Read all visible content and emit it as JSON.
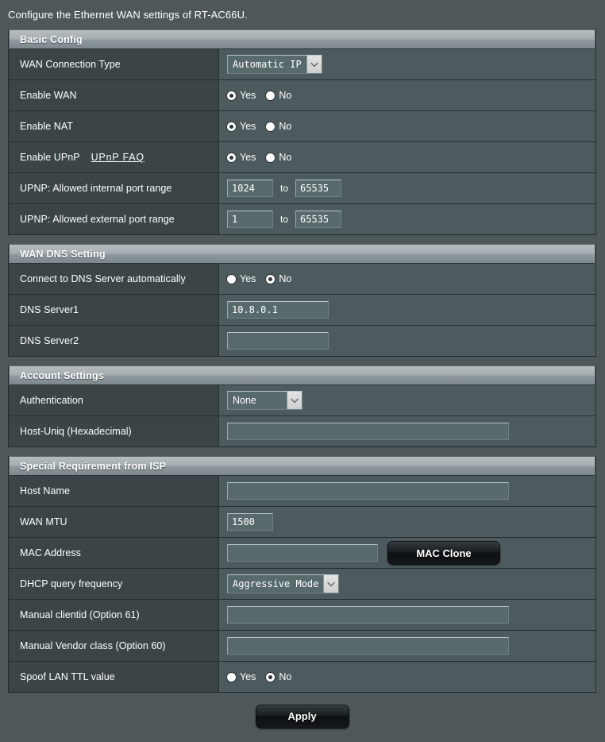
{
  "page": {
    "intro": "Configure the Ethernet WAN settings of RT-AC66U."
  },
  "sections": {
    "basic_config": {
      "title": "Basic Config",
      "rows": {
        "wan_connection_type": {
          "label": "WAN Connection Type",
          "value": "Automatic IP"
        },
        "enable_wan": {
          "label": "Enable WAN",
          "yes_label": "Yes",
          "no_label": "No",
          "selected": "Yes"
        },
        "enable_nat": {
          "label": "Enable NAT",
          "yes_label": "Yes",
          "no_label": "No",
          "selected": "Yes"
        },
        "enable_upnp": {
          "label": "Enable UPnP",
          "link_label": "UPnP  FAQ",
          "yes_label": "Yes",
          "no_label": "No",
          "selected": "Yes"
        },
        "upnp_internal_range": {
          "label": "UPNP: Allowed internal port range",
          "from": "1024",
          "separator": "to",
          "to": "65535"
        },
        "upnp_external_range": {
          "label": "UPNP: Allowed external port range",
          "from": "1",
          "separator": "to",
          "to": "65535"
        }
      }
    },
    "wan_dns": {
      "title": "WAN DNS Setting",
      "rows": {
        "connect_dns_auto": {
          "label": "Connect to DNS Server automatically",
          "yes_label": "Yes",
          "no_label": "No",
          "selected": "No"
        },
        "dns_server1": {
          "label": "DNS Server1",
          "value": "10.8.0.1"
        },
        "dns_server2": {
          "label": "DNS Server2",
          "value": ""
        }
      }
    },
    "account_settings": {
      "title": "Account Settings",
      "rows": {
        "authentication": {
          "label": "Authentication",
          "value": "None"
        },
        "host_uniq": {
          "label": "Host-Uniq (Hexadecimal)",
          "value": ""
        }
      }
    },
    "special_isp": {
      "title": "Special Requirement from ISP",
      "rows": {
        "host_name": {
          "label": "Host Name",
          "value": ""
        },
        "wan_mtu": {
          "label": "WAN MTU",
          "value": "1500"
        },
        "mac_address": {
          "label": "MAC Address",
          "value": "",
          "button_label": "MAC Clone"
        },
        "dhcp_query_frequency": {
          "label": "DHCP query frequency",
          "value": "Aggressive Mode"
        },
        "manual_clientid": {
          "label": "Manual clientid (Option 61)",
          "value": ""
        },
        "manual_vendor_class": {
          "label": "Manual Vendor class (Option 60)",
          "value": ""
        },
        "spoof_lan_ttl": {
          "label": "Spoof LAN TTL value",
          "yes_label": "Yes",
          "no_label": "No",
          "selected": "No"
        }
      }
    }
  },
  "footer": {
    "apply_label": "Apply"
  }
}
